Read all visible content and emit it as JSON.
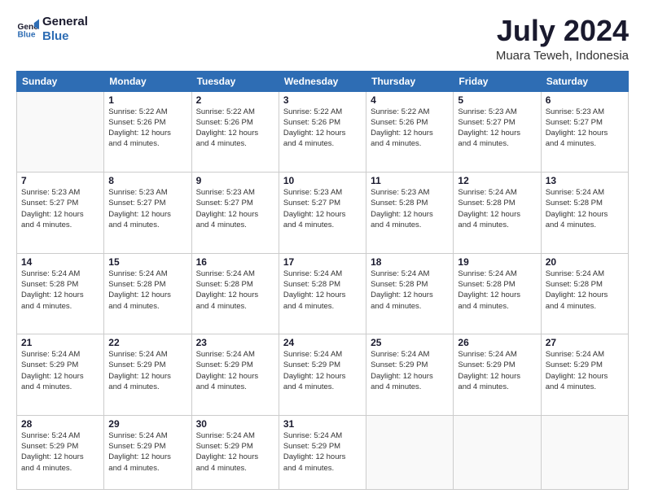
{
  "header": {
    "logo_line1": "General",
    "logo_line2": "Blue",
    "month": "July 2024",
    "location": "Muara Teweh, Indonesia"
  },
  "weekdays": [
    "Sunday",
    "Monday",
    "Tuesday",
    "Wednesday",
    "Thursday",
    "Friday",
    "Saturday"
  ],
  "weeks": [
    [
      {
        "day": "",
        "info": ""
      },
      {
        "day": "1",
        "info": "Sunrise: 5:22 AM\nSunset: 5:26 PM\nDaylight: 12 hours\nand 4 minutes."
      },
      {
        "day": "2",
        "info": "Sunrise: 5:22 AM\nSunset: 5:26 PM\nDaylight: 12 hours\nand 4 minutes."
      },
      {
        "day": "3",
        "info": "Sunrise: 5:22 AM\nSunset: 5:26 PM\nDaylight: 12 hours\nand 4 minutes."
      },
      {
        "day": "4",
        "info": "Sunrise: 5:22 AM\nSunset: 5:26 PM\nDaylight: 12 hours\nand 4 minutes."
      },
      {
        "day": "5",
        "info": "Sunrise: 5:23 AM\nSunset: 5:27 PM\nDaylight: 12 hours\nand 4 minutes."
      },
      {
        "day": "6",
        "info": "Sunrise: 5:23 AM\nSunset: 5:27 PM\nDaylight: 12 hours\nand 4 minutes."
      }
    ],
    [
      {
        "day": "7",
        "info": "Sunrise: 5:23 AM\nSunset: 5:27 PM\nDaylight: 12 hours\nand 4 minutes."
      },
      {
        "day": "8",
        "info": "Sunrise: 5:23 AM\nSunset: 5:27 PM\nDaylight: 12 hours\nand 4 minutes."
      },
      {
        "day": "9",
        "info": "Sunrise: 5:23 AM\nSunset: 5:27 PM\nDaylight: 12 hours\nand 4 minutes."
      },
      {
        "day": "10",
        "info": "Sunrise: 5:23 AM\nSunset: 5:27 PM\nDaylight: 12 hours\nand 4 minutes."
      },
      {
        "day": "11",
        "info": "Sunrise: 5:23 AM\nSunset: 5:28 PM\nDaylight: 12 hours\nand 4 minutes."
      },
      {
        "day": "12",
        "info": "Sunrise: 5:24 AM\nSunset: 5:28 PM\nDaylight: 12 hours\nand 4 minutes."
      },
      {
        "day": "13",
        "info": "Sunrise: 5:24 AM\nSunset: 5:28 PM\nDaylight: 12 hours\nand 4 minutes."
      }
    ],
    [
      {
        "day": "14",
        "info": "Sunrise: 5:24 AM\nSunset: 5:28 PM\nDaylight: 12 hours\nand 4 minutes."
      },
      {
        "day": "15",
        "info": "Sunrise: 5:24 AM\nSunset: 5:28 PM\nDaylight: 12 hours\nand 4 minutes."
      },
      {
        "day": "16",
        "info": "Sunrise: 5:24 AM\nSunset: 5:28 PM\nDaylight: 12 hours\nand 4 minutes."
      },
      {
        "day": "17",
        "info": "Sunrise: 5:24 AM\nSunset: 5:28 PM\nDaylight: 12 hours\nand 4 minutes."
      },
      {
        "day": "18",
        "info": "Sunrise: 5:24 AM\nSunset: 5:28 PM\nDaylight: 12 hours\nand 4 minutes."
      },
      {
        "day": "19",
        "info": "Sunrise: 5:24 AM\nSunset: 5:28 PM\nDaylight: 12 hours\nand 4 minutes."
      },
      {
        "day": "20",
        "info": "Sunrise: 5:24 AM\nSunset: 5:28 PM\nDaylight: 12 hours\nand 4 minutes."
      }
    ],
    [
      {
        "day": "21",
        "info": "Sunrise: 5:24 AM\nSunset: 5:29 PM\nDaylight: 12 hours\nand 4 minutes."
      },
      {
        "day": "22",
        "info": "Sunrise: 5:24 AM\nSunset: 5:29 PM\nDaylight: 12 hours\nand 4 minutes."
      },
      {
        "day": "23",
        "info": "Sunrise: 5:24 AM\nSunset: 5:29 PM\nDaylight: 12 hours\nand 4 minutes."
      },
      {
        "day": "24",
        "info": "Sunrise: 5:24 AM\nSunset: 5:29 PM\nDaylight: 12 hours\nand 4 minutes."
      },
      {
        "day": "25",
        "info": "Sunrise: 5:24 AM\nSunset: 5:29 PM\nDaylight: 12 hours\nand 4 minutes."
      },
      {
        "day": "26",
        "info": "Sunrise: 5:24 AM\nSunset: 5:29 PM\nDaylight: 12 hours\nand 4 minutes."
      },
      {
        "day": "27",
        "info": "Sunrise: 5:24 AM\nSunset: 5:29 PM\nDaylight: 12 hours\nand 4 minutes."
      }
    ],
    [
      {
        "day": "28",
        "info": "Sunrise: 5:24 AM\nSunset: 5:29 PM\nDaylight: 12 hours\nand 4 minutes."
      },
      {
        "day": "29",
        "info": "Sunrise: 5:24 AM\nSunset: 5:29 PM\nDaylight: 12 hours\nand 4 minutes."
      },
      {
        "day": "30",
        "info": "Sunrise: 5:24 AM\nSunset: 5:29 PM\nDaylight: 12 hours\nand 4 minutes."
      },
      {
        "day": "31",
        "info": "Sunrise: 5:24 AM\nSunset: 5:29 PM\nDaylight: 12 hours\nand 4 minutes."
      },
      {
        "day": "",
        "info": ""
      },
      {
        "day": "",
        "info": ""
      },
      {
        "day": "",
        "info": ""
      }
    ]
  ]
}
